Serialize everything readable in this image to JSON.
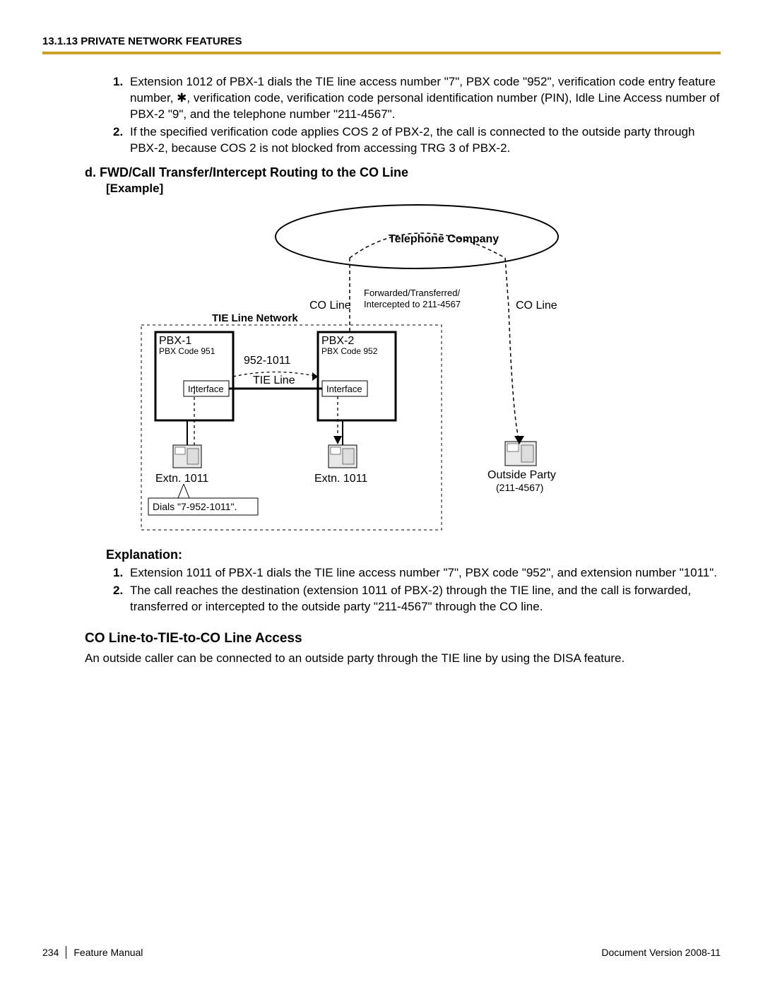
{
  "header": {
    "title": "13.1.13 PRIVATE NETWORK FEATURES"
  },
  "top_list": {
    "items": [
      {
        "num": "1.",
        "text": "Extension 1012 of PBX-1 dials the TIE line access number \"7\", PBX code \"952\", verification code entry feature number, ✱, verification code, verification code personal identification number (PIN), Idle Line Access number of PBX-2 \"9\", and the telephone number \"211-4567\"."
      },
      {
        "num": "2.",
        "text": "If the specified verification code applies COS 2 of PBX-2, the call is connected to the outside party through PBX-2, because COS 2 is not blocked from accessing TRG 3 of PBX-2."
      }
    ]
  },
  "section_d": {
    "heading": "d.  FWD/Call Transfer/Intercept Routing to the CO Line",
    "example_label": "[Example]"
  },
  "diagram": {
    "telco": "Telephone Company",
    "co_line_left": "CO Line",
    "co_line_right": "CO Line",
    "fwd_line1": "Forwarded/Transferred/",
    "fwd_line2": "Intercepted to 211-4567",
    "tie_net": "TIE Line Network",
    "pbx1": "PBX-1",
    "pbx1_code": "PBX Code 951",
    "pbx2": "PBX-2",
    "pbx2_code": "PBX Code 952",
    "dial_num": "952-1011",
    "tie_line": "TIE Line",
    "interface1": "Interface",
    "interface2": "Interface",
    "extn1": "Extn. 1011",
    "extn2": "Extn. 1011",
    "dials_box": "Dials \"7-952-1011\".",
    "outside_party": "Outside Party",
    "outside_num": "(211-4567)"
  },
  "explanation": {
    "heading": "Explanation:",
    "items": [
      {
        "num": "1.",
        "text": "Extension 1011 of PBX-1 dials the TIE line access number \"7\", PBX code \"952\", and extension number \"1011\"."
      },
      {
        "num": "2.",
        "text": "The call reaches the destination (extension 1011 of PBX-2) through the TIE line, and the call is forwarded, transferred or intercepted to the outside party \"211-4567\" through the CO line."
      }
    ]
  },
  "co_section": {
    "heading": "CO Line-to-TIE-to-CO Line Access",
    "para": "An outside caller can be connected to an outside party through the TIE line by using the DISA feature."
  },
  "footer": {
    "page": "234",
    "manual": "Feature Manual",
    "version": "Document Version  2008-11"
  }
}
